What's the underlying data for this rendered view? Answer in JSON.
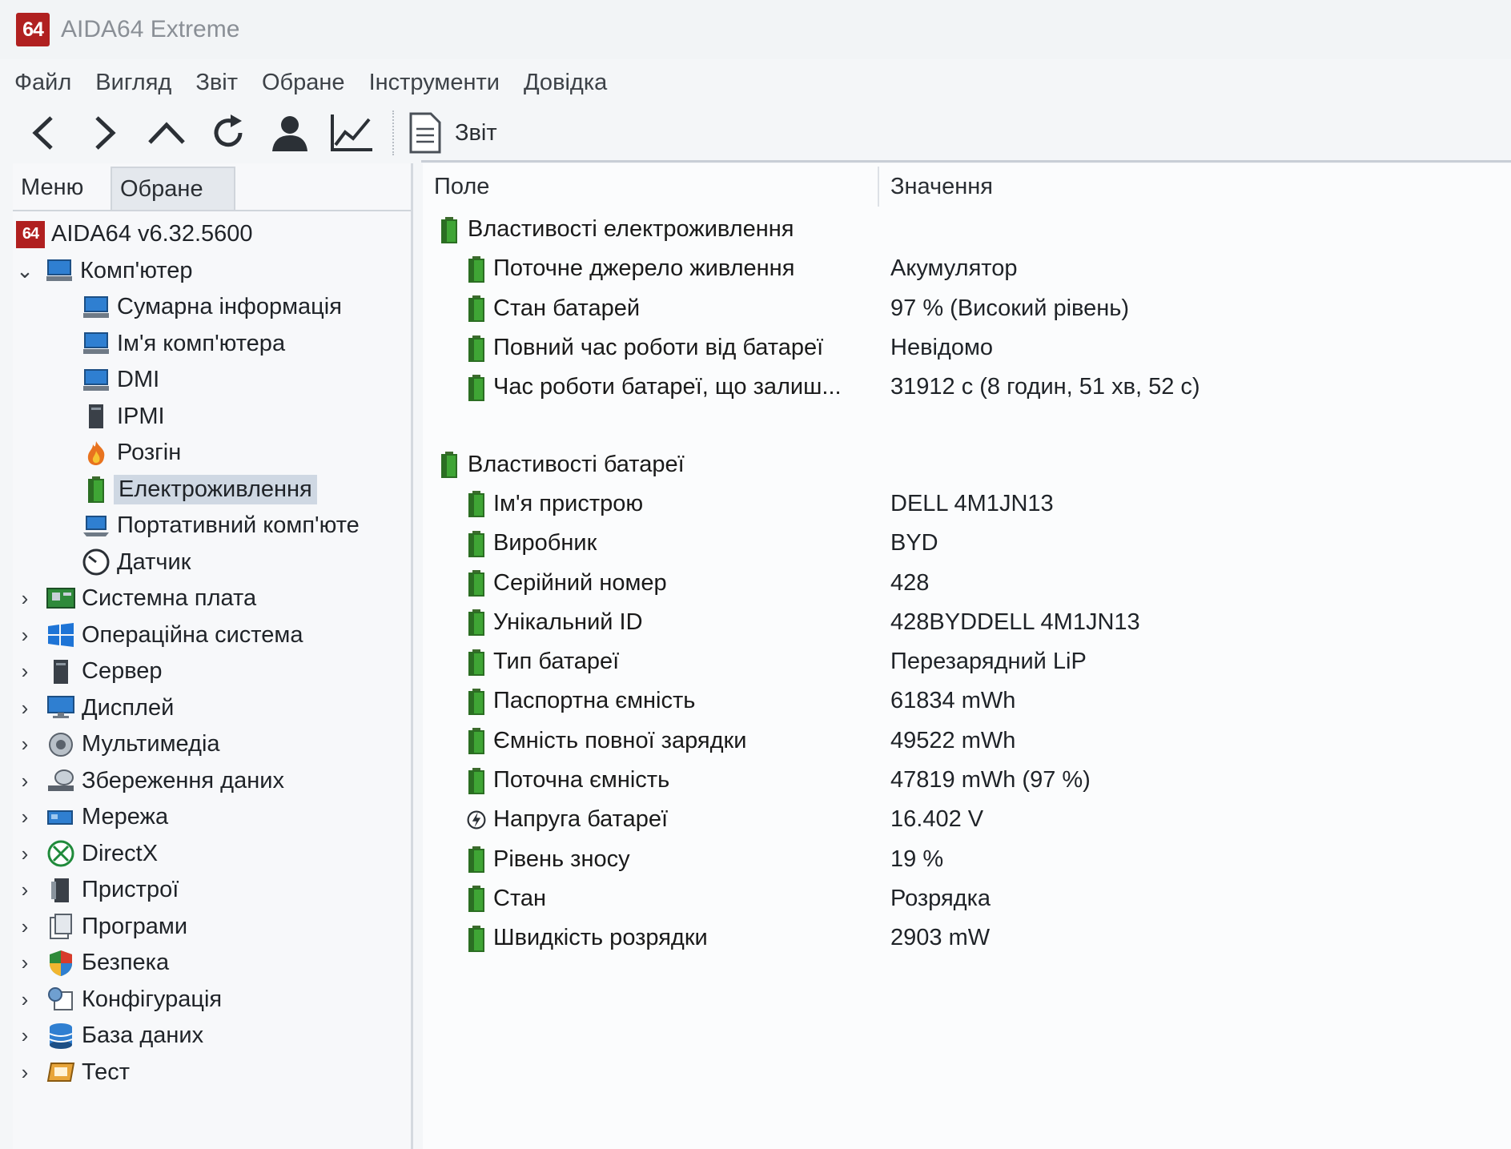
{
  "window": {
    "logo_text": "64",
    "title": "AIDA64 Extreme"
  },
  "menu": [
    "Файл",
    "Вигляд",
    "Звіт",
    "Обране",
    "Інструменти",
    "Довідка"
  ],
  "toolbar": {
    "buttons": [
      "back-icon",
      "forward-icon",
      "up-icon",
      "refresh-icon",
      "user-icon",
      "chart-icon"
    ],
    "report_label": "Звіт"
  },
  "left_tabs": {
    "menu": "Меню",
    "favorites": "Обране"
  },
  "tree": {
    "root": "AIDA64 v6.32.5600",
    "computer": "Комп'ютер",
    "computer_children": [
      "Сумарна інформація",
      "Ім'я комп'ютера",
      "DMI",
      "IPMI",
      "Розгін",
      "Електроживлення",
      "Портативний комп'юте",
      "Датчик"
    ],
    "selected": "Електроживлення",
    "categories": [
      "Системна плата",
      "Операційна система",
      "Сервер",
      "Дисплей",
      "Мультимедіа",
      "Збереження даних",
      "Мережа",
      "DirectX",
      "Пристрої",
      "Програми",
      "Безпека",
      "Конфігурація",
      "База даних",
      "Тест"
    ]
  },
  "columns": {
    "field": "Поле",
    "value": "Значення"
  },
  "sections": [
    {
      "title": "Властивості електроживлення",
      "rows": [
        {
          "field": "Поточне джерело живлення",
          "value": "Акумулятор"
        },
        {
          "field": "Стан батарей",
          "value": "97 % (Високий рівень)"
        },
        {
          "field": "Повний час роботи від батареї",
          "value": "Невідомо"
        },
        {
          "field": "Час роботи батареї, що залиш...",
          "value": "31912 с (8 годин, 51 хв, 52 с)"
        }
      ]
    },
    {
      "title": "Властивості батареї",
      "rows": [
        {
          "field": "Ім'я пристрою",
          "value": "DELL 4M1JN13"
        },
        {
          "field": "Виробник",
          "value": "BYD"
        },
        {
          "field": "Серійний номер",
          "value": "428"
        },
        {
          "field": "Унікальний ID",
          "value": "428BYDDELL 4M1JN13"
        },
        {
          "field": "Тип батареї",
          "value": "Перезарядний LiP"
        },
        {
          "field": "Паспортна ємність",
          "value": "61834 mWh"
        },
        {
          "field": "Ємність повної зарядки",
          "value": "49522 mWh"
        },
        {
          "field": "Поточна ємність",
          "value": "47819 mWh  (97 %)"
        },
        {
          "field": "Напруга батареї",
          "value": "16.402 V",
          "icon": "voltage-icon"
        },
        {
          "field": "Рівень зносу",
          "value": "19 %"
        },
        {
          "field": "Стан",
          "value": "Розрядка"
        },
        {
          "field": "Швидкість розрядки",
          "value": "2903 mW"
        }
      ]
    }
  ]
}
